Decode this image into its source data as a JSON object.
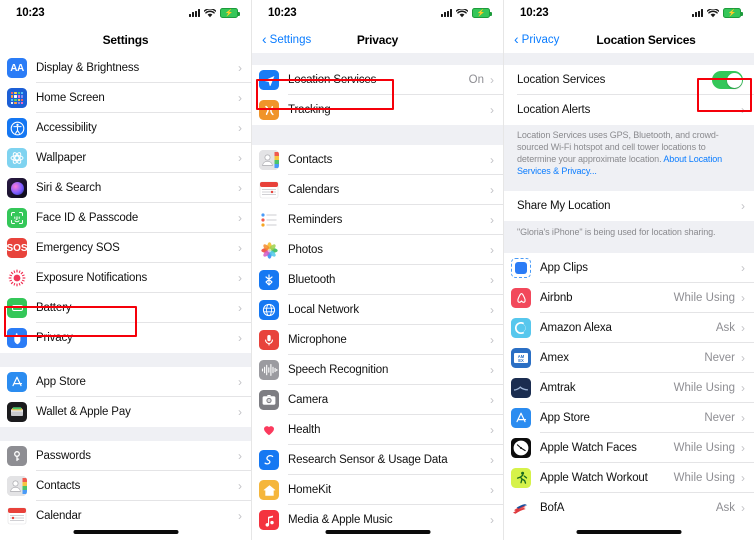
{
  "statusbar": {
    "time": "10:23",
    "signal_icon": "cellular-signal-icon",
    "wifi_icon": "wifi-icon",
    "battery_icon": "battery-charging-icon"
  },
  "colors": {
    "accent": "#0a7cff",
    "highlight": "#f5000a",
    "toggle_on": "#34c759",
    "group_bg": "#eff0f4",
    "secondary_text": "#8e8e93"
  },
  "panels": [
    {
      "id": "settings",
      "nav": {
        "title": "Settings",
        "back_label": null
      },
      "groups": [
        {
          "lead_gap": 0,
          "rows": [
            {
              "label": "Display & Brightness",
              "icon": "display-brightness-icon",
              "value": null,
              "chevron": true
            },
            {
              "label": "Home Screen",
              "icon": "home-screen-icon",
              "value": null,
              "chevron": true
            },
            {
              "label": "Accessibility",
              "icon": "accessibility-icon",
              "value": null,
              "chevron": true
            },
            {
              "label": "Wallpaper",
              "icon": "wallpaper-icon",
              "value": null,
              "chevron": true
            },
            {
              "label": "Siri & Search",
              "icon": "siri-search-icon",
              "value": null,
              "chevron": true
            },
            {
              "label": "Face ID & Passcode",
              "icon": "face-id-icon",
              "value": null,
              "chevron": true
            },
            {
              "label": "Emergency SOS",
              "icon": "emergency-sos-icon",
              "value": null,
              "chevron": true
            },
            {
              "label": "Exposure Notifications",
              "icon": "exposure-notifications-icon",
              "value": null,
              "chevron": true
            },
            {
              "label": "Battery",
              "icon": "battery-icon",
              "value": null,
              "chevron": true
            },
            {
              "label": "Privacy",
              "icon": "privacy-icon",
              "value": null,
              "chevron": true,
              "highlighted": true
            }
          ]
        },
        {
          "lead_gap": 14,
          "rows": [
            {
              "label": "App Store",
              "icon": "app-store-icon",
              "value": null,
              "chevron": true
            },
            {
              "label": "Wallet & Apple Pay",
              "icon": "wallet-apple-pay-icon",
              "value": null,
              "chevron": true
            }
          ]
        },
        {
          "lead_gap": 14,
          "rows": [
            {
              "label": "Passwords",
              "icon": "passwords-icon",
              "value": null,
              "chevron": true
            },
            {
              "label": "Contacts",
              "icon": "contacts-icon",
              "value": null,
              "chevron": true
            },
            {
              "label": "Calendar",
              "icon": "calendar-icon",
              "value": null,
              "chevron": true
            }
          ]
        }
      ]
    },
    {
      "id": "privacy",
      "nav": {
        "title": "Privacy",
        "back_label": "Settings"
      },
      "groups": [
        {
          "lead_gap": 12,
          "rows": [
            {
              "label": "Location Services",
              "icon": "location-services-icon",
              "value": "On",
              "chevron": true,
              "highlighted": true
            },
            {
              "label": "Tracking",
              "icon": "tracking-icon",
              "value": null,
              "chevron": true
            }
          ]
        },
        {
          "lead_gap": 20,
          "rows": [
            {
              "label": "Contacts",
              "icon": "contacts-icon",
              "value": null,
              "chevron": true
            },
            {
              "label": "Calendars",
              "icon": "calendars-icon",
              "value": null,
              "chevron": true
            },
            {
              "label": "Reminders",
              "icon": "reminders-icon",
              "value": null,
              "chevron": true
            },
            {
              "label": "Photos",
              "icon": "photos-icon",
              "value": null,
              "chevron": true
            },
            {
              "label": "Bluetooth",
              "icon": "bluetooth-icon",
              "value": null,
              "chevron": true
            },
            {
              "label": "Local Network",
              "icon": "local-network-icon",
              "value": null,
              "chevron": true
            },
            {
              "label": "Microphone",
              "icon": "microphone-icon",
              "value": null,
              "chevron": true
            },
            {
              "label": "Speech Recognition",
              "icon": "speech-recognition-icon",
              "value": null,
              "chevron": true
            },
            {
              "label": "Camera",
              "icon": "camera-icon",
              "value": null,
              "chevron": true
            },
            {
              "label": "Health",
              "icon": "health-icon",
              "value": null,
              "chevron": true
            },
            {
              "label": "Research Sensor & Usage Data",
              "icon": "research-sensor-icon",
              "value": null,
              "chevron": true
            },
            {
              "label": "HomeKit",
              "icon": "homekit-icon",
              "value": null,
              "chevron": true
            },
            {
              "label": "Media & Apple Music",
              "icon": "media-apple-music-icon",
              "value": null,
              "chevron": true
            }
          ]
        }
      ]
    },
    {
      "id": "location-services",
      "nav": {
        "title": "Location Services",
        "back_label": "Privacy"
      },
      "toggle_row": {
        "label": "Location Services",
        "state": "on",
        "highlighted": true
      },
      "alerts_row": {
        "label": "Location Alerts",
        "chevron": true
      },
      "footer_text": "Location Services uses GPS, Bluetooth, and crowd-sourced Wi-Fi hotspot and cell tower locations to determine your approximate location. ",
      "footer_link": "About Location Services & Privacy...",
      "share_row": {
        "label": "Share My Location",
        "chevron": true
      },
      "share_footer": "\"Gloria's iPhone\" is being used for location sharing.",
      "apps": [
        {
          "label": "App Clips",
          "icon": "app-clips-icon",
          "value": null,
          "chevron": true
        },
        {
          "label": "Airbnb",
          "icon": "airbnb-icon",
          "value": "While Using",
          "chevron": true
        },
        {
          "label": "Amazon Alexa",
          "icon": "amazon-alexa-icon",
          "value": "Ask",
          "chevron": true
        },
        {
          "label": "Amex",
          "icon": "amex-icon",
          "value": "Never",
          "chevron": true
        },
        {
          "label": "Amtrak",
          "icon": "amtrak-icon",
          "value": "While Using",
          "chevron": true
        },
        {
          "label": "App Store",
          "icon": "app-store-icon",
          "value": "Never",
          "chevron": true
        },
        {
          "label": "Apple Watch Faces",
          "icon": "apple-watch-faces-icon",
          "value": "While Using",
          "chevron": true
        },
        {
          "label": "Apple Watch Workout",
          "icon": "apple-watch-workout-icon",
          "value": "While Using",
          "chevron": true
        },
        {
          "label": "BofA",
          "icon": "bofa-icon",
          "value": "Ask",
          "chevron": true
        }
      ]
    }
  ]
}
